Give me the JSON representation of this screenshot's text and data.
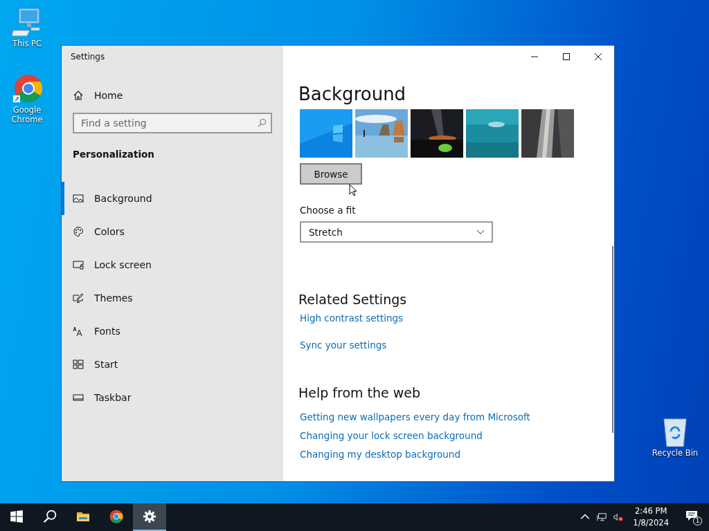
{
  "desktop_icons": [
    {
      "kind": "computer",
      "label": "This PC"
    },
    {
      "kind": "chrome",
      "label": "Google Chrome"
    },
    {
      "kind": "recycle",
      "label": "Recycle Bin"
    }
  ],
  "window": {
    "title": "Settings",
    "sidebar": {
      "home": "Home",
      "search": {
        "placeholder": "Find a setting"
      },
      "section": "Personalization",
      "items": [
        {
          "kind": "picture",
          "label": "Background",
          "selected": true
        },
        {
          "kind": "palette",
          "label": "Colors",
          "selected": false
        },
        {
          "kind": "lock-screen",
          "label": "Lock screen",
          "selected": false
        },
        {
          "kind": "brush",
          "label": "Themes",
          "selected": false
        },
        {
          "kind": "fonts",
          "label": "Fonts",
          "selected": false
        },
        {
          "kind": "tiles",
          "label": "Start",
          "selected": false
        },
        {
          "kind": "taskbar",
          "label": "Taskbar",
          "selected": false
        }
      ]
    },
    "content": {
      "heading": "Background",
      "browse_button": "Browse",
      "fit": {
        "label": "Choose a fit",
        "value": "Stretch"
      },
      "related": {
        "heading": "Related Settings",
        "links": [
          "High contrast settings",
          "Sync your settings"
        ]
      },
      "help": {
        "heading": "Help from the web",
        "links": [
          "Getting new wallpapers every day from Microsoft",
          "Changing your lock screen background",
          "Changing my desktop background"
        ]
      }
    }
  },
  "taskbar": {
    "apps": [
      {
        "kind": "start",
        "active": false
      },
      {
        "kind": "search",
        "active": false
      },
      {
        "kind": "folder",
        "active": false
      },
      {
        "kind": "chrome",
        "active": false
      },
      {
        "kind": "settings",
        "active": true
      }
    ],
    "time": "2:46 PM",
    "date": "1/8/2024",
    "notifications": "1"
  }
}
